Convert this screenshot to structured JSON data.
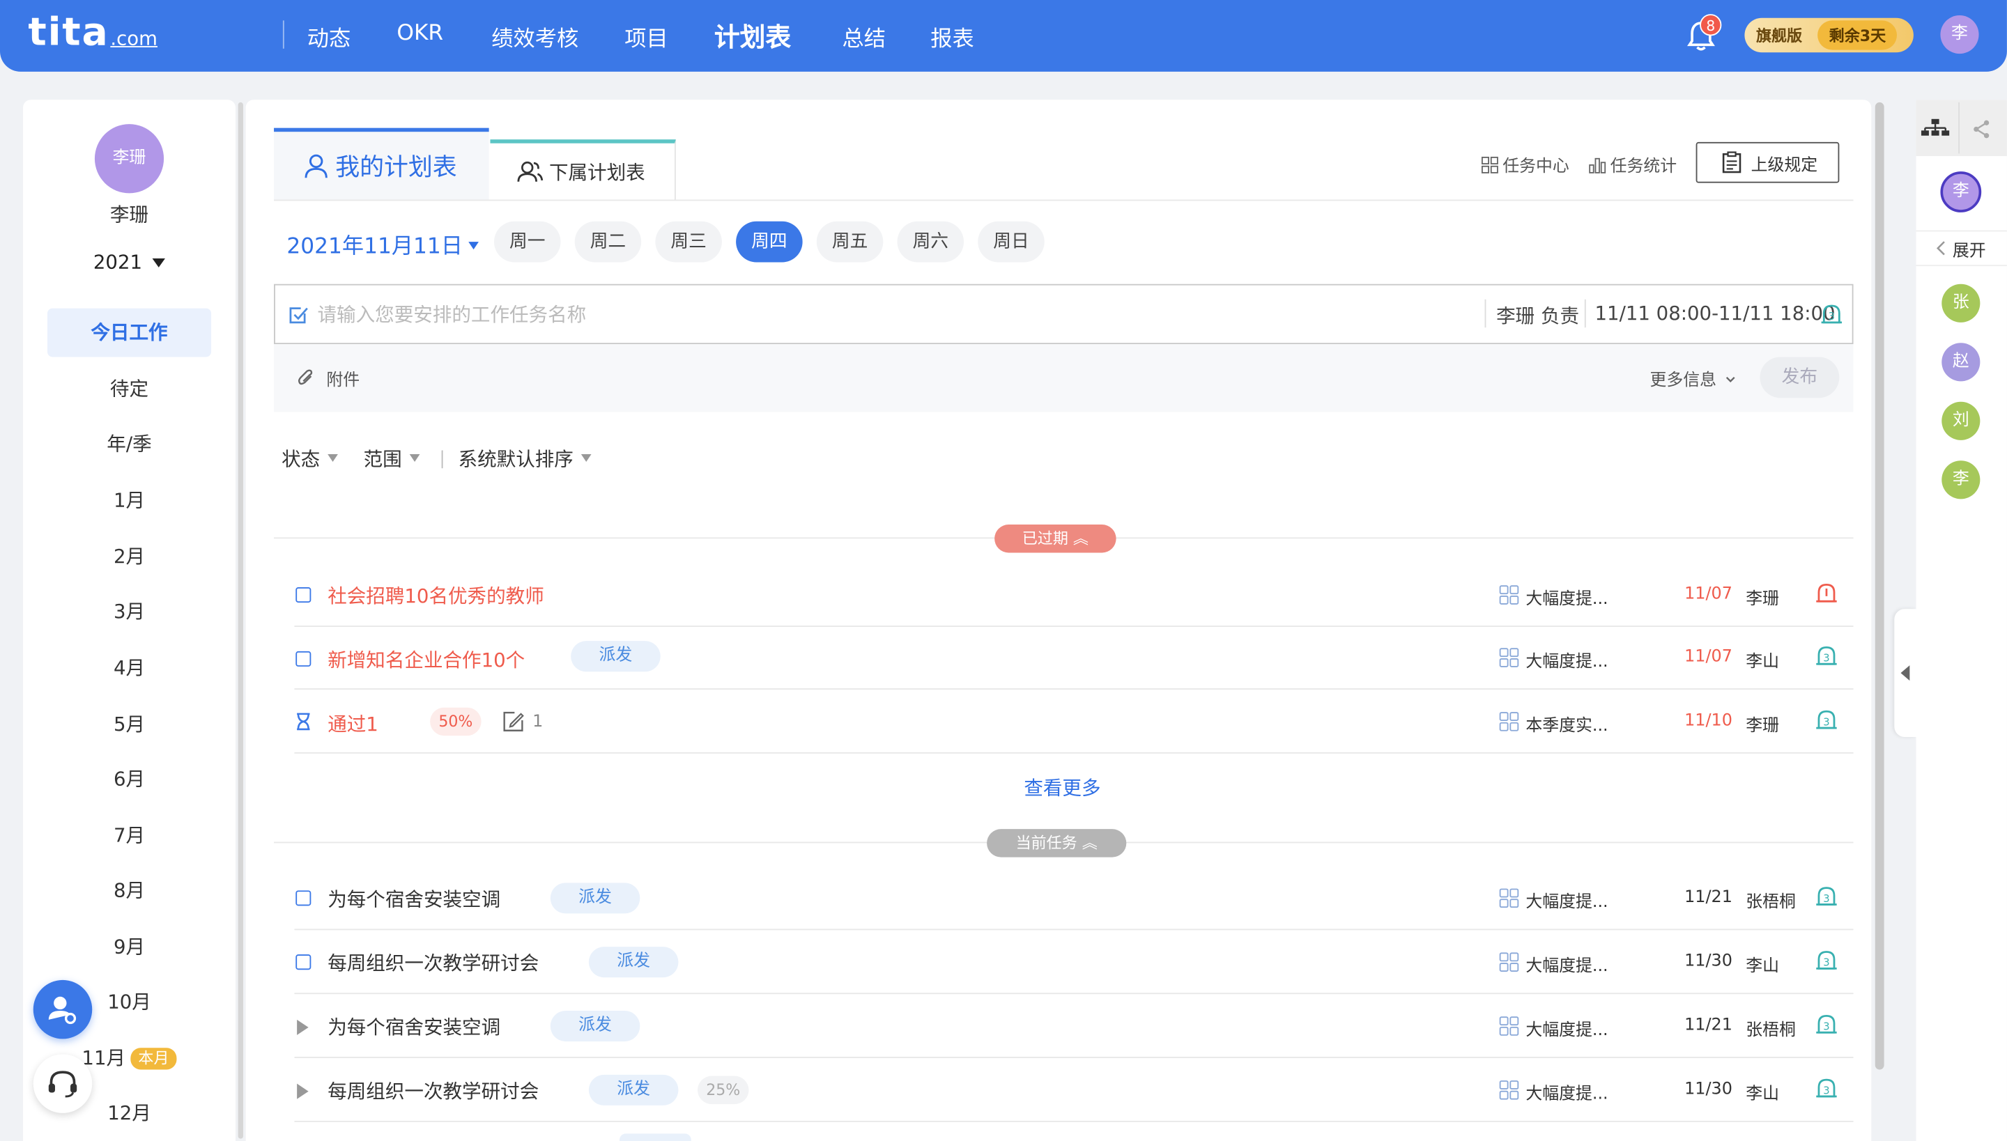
{
  "topbar": {
    "logo_main": "tita",
    "logo_suffix": ".com",
    "nav": [
      "动态",
      "OKR",
      "绩效考核",
      "项目",
      "计划表",
      "总结",
      "报表"
    ],
    "nav_active_index": 4,
    "bell_count": "8",
    "plan_name": "旗舰版",
    "plan_remaining": "剩余3天",
    "avatar_text": "李"
  },
  "sidebar": {
    "avatar_text": "李珊",
    "user_name": "李珊",
    "year": "2021",
    "items": [
      "今日工作",
      "待定",
      "年/季",
      "1月",
      "2月",
      "3月",
      "4月",
      "5月",
      "6月",
      "7月",
      "8月",
      "9月",
      "10月",
      "11月",
      "12月"
    ],
    "active_index": 0,
    "current_month_tag": "本月"
  },
  "tabs": {
    "mine": "我的计划表",
    "subordinate": "下属计划表"
  },
  "toolbar": {
    "task_center": "任务中心",
    "task_stats": "任务统计",
    "superior_rules": "上级规定"
  },
  "date_bar": {
    "date": "2021年11月11日",
    "days": [
      "周一",
      "周二",
      "周三",
      "周四",
      "周五",
      "周六",
      "周日"
    ],
    "active_day_index": 3
  },
  "task_input": {
    "placeholder": "请输入您要安排的工作任务名称",
    "value": "",
    "owner": "李珊 负责",
    "time_range": "11/11 08:00-11/11 18:00"
  },
  "extra": {
    "attachment": "附件",
    "more_info": "更多信息",
    "publish": "发布"
  },
  "filters": {
    "status": "状态",
    "scope": "范围",
    "sort": "系统默认排序"
  },
  "overdue": {
    "label": "已过期",
    "rows": [
      {
        "title": "社会招聘10名优秀的教师",
        "tag": "",
        "progress": "",
        "kr": "大幅度提...",
        "date": "11/07",
        "owner": "李珊"
      },
      {
        "title": "新增知名企业合作10个",
        "tag": "派发",
        "progress": "",
        "kr": "大幅度提...",
        "date": "11/07",
        "owner": "李山"
      },
      {
        "title": "通过1",
        "tag": "",
        "progress": "50%",
        "note_count": "1",
        "kr": "本季度实...",
        "date": "11/10",
        "owner": "李珊"
      }
    ],
    "see_more": "查看更多"
  },
  "current": {
    "label": "当前任务",
    "rows": [
      {
        "title": "为每个宿舍安装空调",
        "tag": "派发",
        "progress": "",
        "kr": "大幅度提...",
        "date": "11/21",
        "owner": "张梧桐"
      },
      {
        "title": "每周组织一次教学研讨会",
        "tag": "派发",
        "progress": "",
        "kr": "大幅度提...",
        "date": "11/30",
        "owner": "李山"
      },
      {
        "title": "为每个宿舍安装空调",
        "tag": "派发",
        "progress": "",
        "kr": "大幅度提...",
        "date": "11/21",
        "owner": "张梧桐"
      },
      {
        "title": "每周组织一次教学研讨会",
        "tag": "派发",
        "progress": "25%",
        "kr": "大幅度提...",
        "date": "11/30",
        "owner": "李山"
      }
    ]
  },
  "right_panel": {
    "expand_label": "展开",
    "me": "李",
    "members": [
      {
        "text": "张",
        "color": "#a6c85a"
      },
      {
        "text": "赵",
        "color": "#a69be0"
      },
      {
        "text": "刘",
        "color": "#a6c85a"
      },
      {
        "text": "李",
        "color": "#a6c85a"
      }
    ]
  },
  "colors": {
    "primary": "#3b78e7",
    "overdue_red": "#ef5b4c",
    "overdue_pill": "#ee8a80",
    "current_pill": "#b5b5b5",
    "alarm_teal": "#38b0b0",
    "plan_gold": "#f2b93b"
  },
  "icons": [
    "bell-icon",
    "user-icon",
    "users-icon",
    "grid-icon",
    "bar-chart-icon",
    "clipboard-icon",
    "check-square-icon",
    "alarm-icon",
    "paperclip-icon",
    "hourglass-icon",
    "edit-note-icon",
    "org-chart-icon",
    "share-icon",
    "headset-icon",
    "user-settings-icon"
  ]
}
